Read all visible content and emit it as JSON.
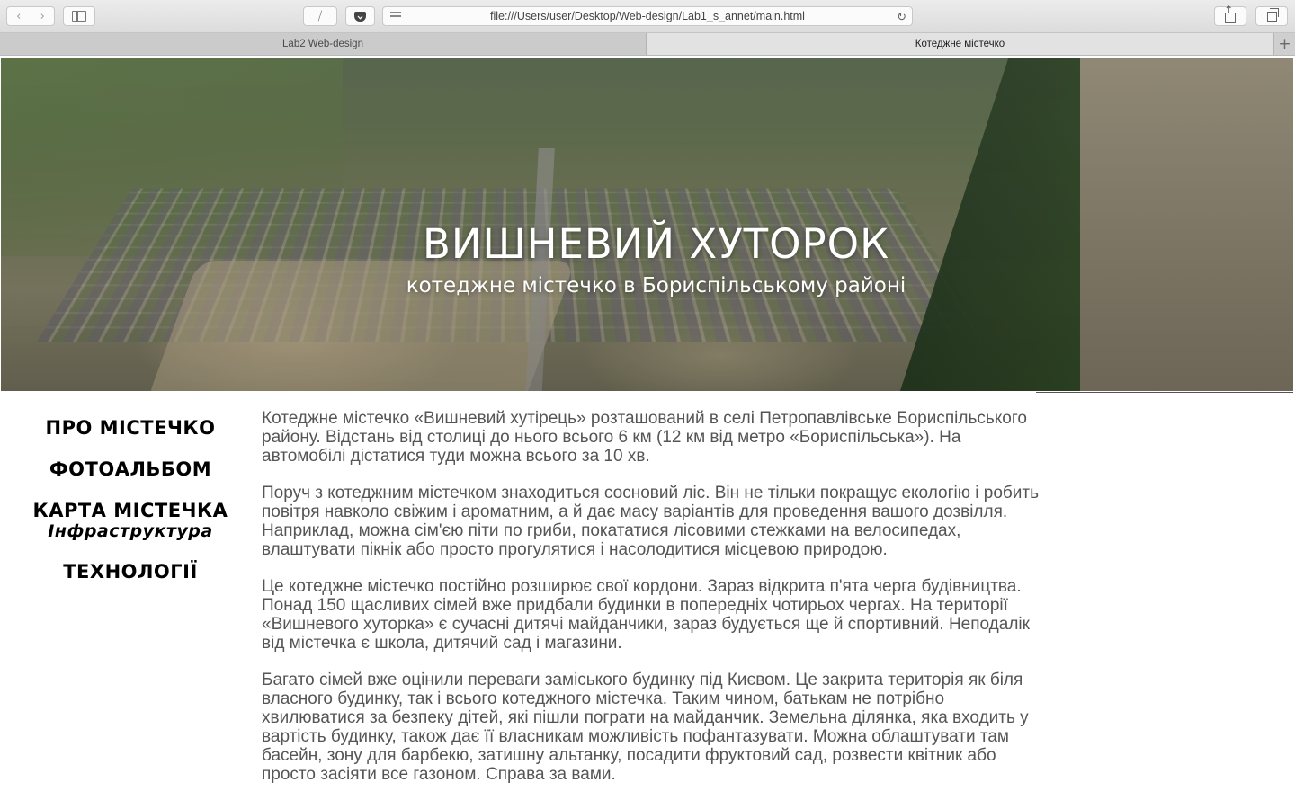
{
  "browser": {
    "url": "file:///Users/user/Desktop/Web-design/Lab1_s_annet/main.html",
    "tabs": [
      {
        "label": "Lab2 Web-design",
        "active": false
      },
      {
        "label": "Котеджне містечко",
        "active": true
      }
    ],
    "new_tab_symbol": "+"
  },
  "hero": {
    "title": "ВИШНЕВИЙ ХУТОРОК",
    "subtitle": "котеджне містечко в Бориспільському районі"
  },
  "nav": {
    "items": [
      {
        "label": "ПРО МІСТЕЧКО"
      },
      {
        "label": "ФОТОАЛЬБОМ"
      },
      {
        "label": "КАРТА МІСТЕЧКА"
      },
      {
        "label": "ТЕХНОЛОГІЇ"
      }
    ],
    "sub_label": "Інфраструктура"
  },
  "content": {
    "paragraphs": [
      "Котеджне містечко «Вишневий хутірець» розташований в селі Петропавлівське Бориспільського району. Відстань від столиці до нього всього 6 км (12 км від метро «Бориспільська»). На автомобілі дістатися туди можна всього за 10 хв.",
      "Поруч з котеджним містечком знаходиться сосновий ліс. Він не тільки покращує екологію і робить повітря навколо свіжим і ароматним, а й дає масу варіантів для проведення вашого дозвілля. Наприклад, можна сім'єю піти по гриби, покататися лісовими стежками на велосипедах, влаштувати пікнік або просто прогулятися і насолодитися місцевою природою.",
      "Це котеджне містечко постійно розширює свої кордони. Зараз відкрита п'ята черга будівництва. Понад 150 щасливих сімей вже придбали будинки в попередніх чотирьох чергах. На території «Вишневого хуторка» є сучасні дитячі майданчики, зараз будується ще й спортивний. Неподалік від містечка є школа, дитячий сад і магазини.",
      "Багато сімей вже оцінили переваги заміського будинку під Києвом. Це закрита територія як біля власного будинку, так і всього котеджного містечка. Таким чином, батькам не потрібно хвилюватися за безпеку дітей, які пішли пограти на майданчик. Земельна ділянка, яка входить у вартість будинку, також дає її власникам можливість пофантазувати. Можна облаштувати там басейн, зону для барбекю, затишну альтанку, посадити фруктовий сад, розвести квітник або просто засіяти все газоном. Справа за вами."
    ]
  },
  "icons": {
    "back": "chevron-left-icon",
    "forward": "chevron-right-icon",
    "sidebar": "sidebar-icon",
    "mask": "hide-icon",
    "pocket": "pocket-icon",
    "reader": "reader-icon",
    "reload": "reload-icon",
    "share": "share-icon",
    "tabs": "tabs-overview-icon"
  }
}
